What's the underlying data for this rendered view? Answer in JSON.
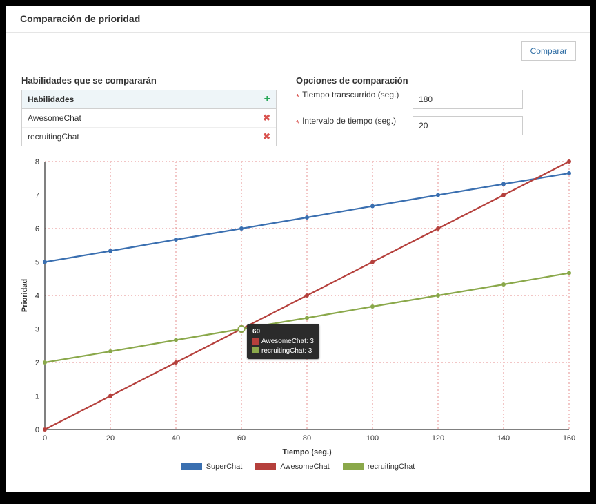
{
  "header": {
    "title": "Comparación de prioridad"
  },
  "actions": {
    "compare_label": "Comparar"
  },
  "skills": {
    "section_title": "Habilidades que se compararán",
    "table_header": "Habilidades",
    "items": [
      {
        "name": "AwesomeChat"
      },
      {
        "name": "recruitingChat"
      }
    ]
  },
  "options": {
    "section_title": "Opciones de comparación",
    "elapsed_label": "Tiempo transcurrido (seg.)",
    "elapsed_value": "180",
    "interval_label": "Intervalo de tiempo (seg.)",
    "interval_value": "20"
  },
  "chart_data": {
    "type": "line",
    "title": "",
    "xlabel": "Tiempo (seg.)",
    "ylabel": "Prioridad",
    "xlim": [
      0,
      160
    ],
    "ylim": [
      0,
      8
    ],
    "xticks": [
      0,
      20,
      40,
      60,
      80,
      100,
      120,
      140,
      160
    ],
    "yticks": [
      0,
      1,
      2,
      3,
      4,
      5,
      6,
      7,
      8
    ],
    "categories": [
      0,
      20,
      40,
      60,
      80,
      100,
      120,
      140,
      160
    ],
    "series": [
      {
        "name": "SuperChat",
        "color": "#3a6fb0",
        "values": [
          5.0,
          5.33,
          5.67,
          6.0,
          6.33,
          6.67,
          7.0,
          7.33,
          7.65
        ]
      },
      {
        "name": "AwesomeChat",
        "color": "#b5403c",
        "values": [
          0,
          1,
          2,
          3,
          4,
          5,
          6,
          7,
          8
        ]
      },
      {
        "name": "recruitingChat",
        "color": "#8aa84a",
        "values": [
          2.0,
          2.33,
          2.67,
          3.0,
          3.33,
          3.67,
          4.0,
          4.33,
          4.67
        ]
      }
    ],
    "tooltip": {
      "x": 60,
      "rows": [
        {
          "label": "AwesomeChat",
          "value": 3,
          "color": "#b5403c"
        },
        {
          "label": "recruitingChat",
          "value": 3,
          "color": "#8aa84a"
        }
      ]
    }
  },
  "legend": {
    "items": [
      {
        "label": "SuperChat",
        "color": "#3a6fb0"
      },
      {
        "label": "AwesomeChat",
        "color": "#b5403c"
      },
      {
        "label": "recruitingChat",
        "color": "#8aa84a"
      }
    ]
  }
}
